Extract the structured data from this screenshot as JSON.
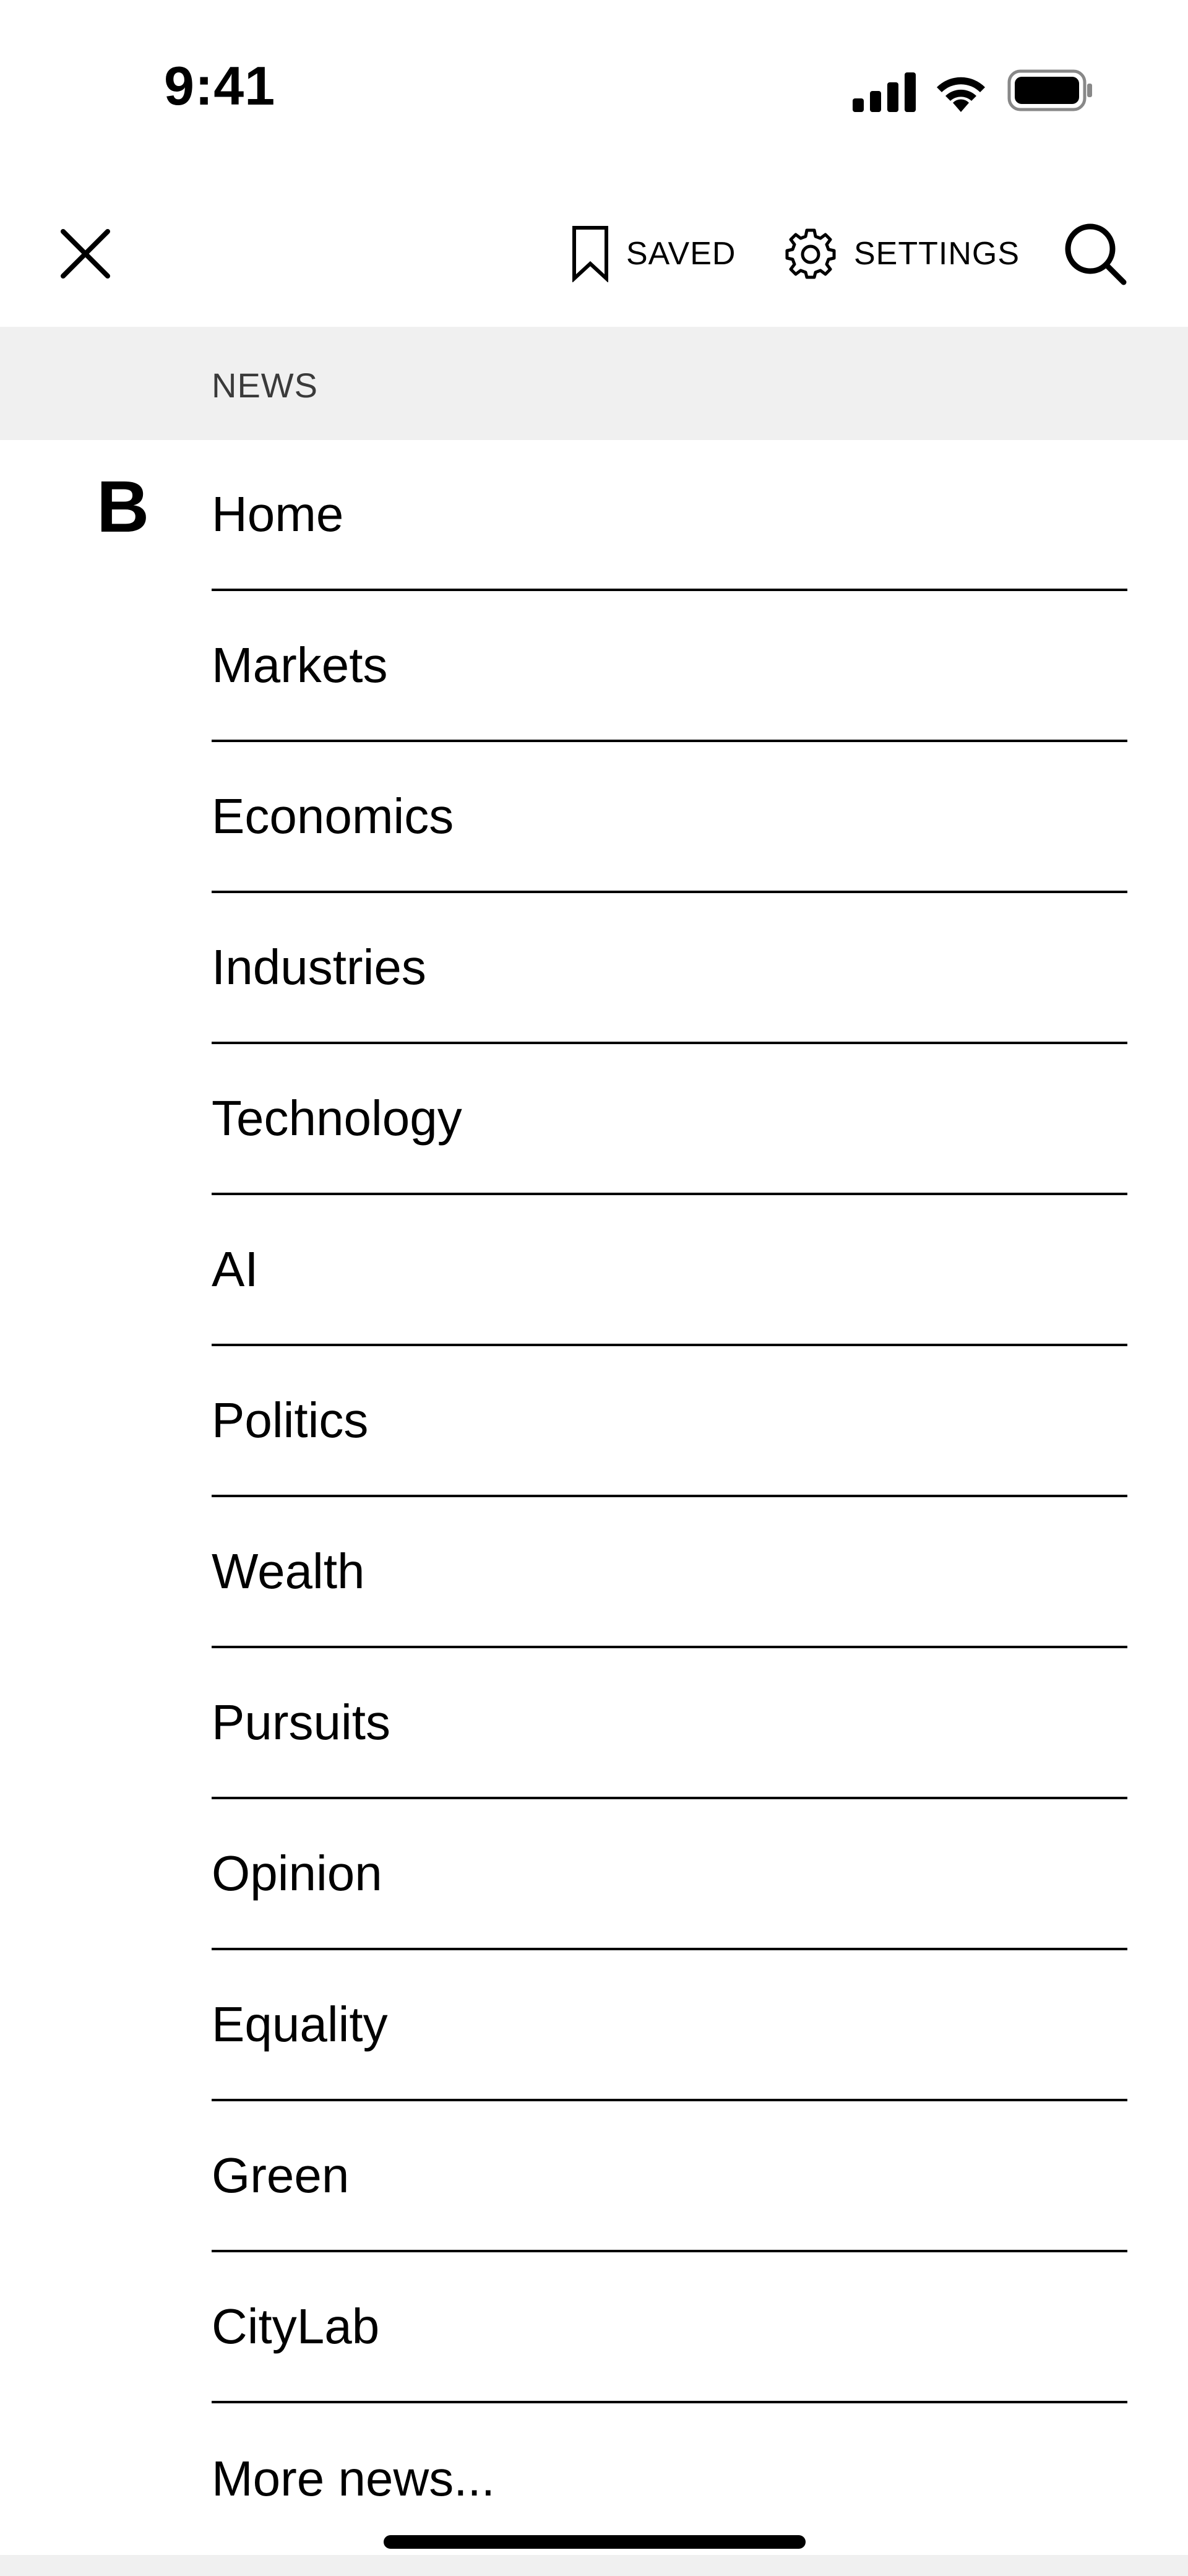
{
  "status_bar": {
    "time": "9:41"
  },
  "topnav": {
    "close_icon": "close-icon",
    "saved_label": "SAVED",
    "settings_label": "SETTINGS",
    "search_icon": "search-icon"
  },
  "section": {
    "label": "NEWS"
  },
  "brand": {
    "logo_text": "B"
  },
  "nav": {
    "items": [
      {
        "label": "Home"
      },
      {
        "label": "Markets"
      },
      {
        "label": "Economics"
      },
      {
        "label": "Industries"
      },
      {
        "label": "Technology"
      },
      {
        "label": "AI"
      },
      {
        "label": "Politics"
      },
      {
        "label": "Wealth"
      },
      {
        "label": "Pursuits"
      },
      {
        "label": "Opinion"
      },
      {
        "label": "Equality"
      },
      {
        "label": "Green"
      },
      {
        "label": "CityLab"
      },
      {
        "label": "More news..."
      }
    ]
  }
}
